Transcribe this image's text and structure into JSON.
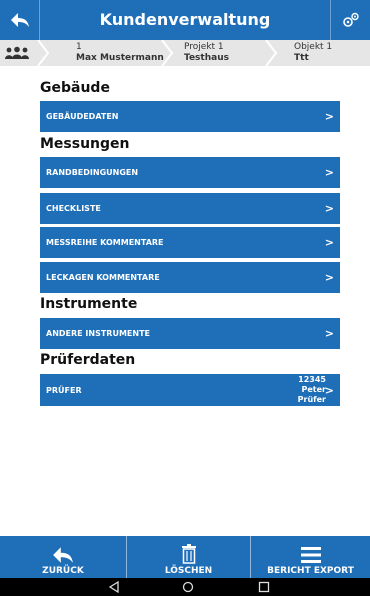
{
  "header": {
    "title": "Kundenverwaltung"
  },
  "breadcrumb": [
    {
      "line1": "1",
      "line2": "Max Mustermann"
    },
    {
      "line1": "Projekt 1",
      "line2": "Testhaus"
    },
    {
      "line1": "Objekt 1",
      "line2": "Ttt"
    }
  ],
  "sections": {
    "gebaeude": {
      "title": "Gebäude",
      "items": [
        "GEBÄUDEDATEN"
      ]
    },
    "messungen": {
      "title": "Messungen",
      "items": [
        "RANDBEDINGUNGEN",
        "CHECKLISTE",
        "MESSREIHE KOMMENTARE",
        "LECKAGEN KOMMENTARE"
      ]
    },
    "instrumente": {
      "title": "Instrumente",
      "items": [
        "ANDERE INSTRUMENTE"
      ]
    },
    "prueferdaten": {
      "title": "Prüferdaten",
      "items": [
        "PRÜFER"
      ],
      "pruefer_info": [
        "12345",
        "Peter",
        "Prüfer"
      ]
    }
  },
  "arrow_symbol": ">",
  "bottom_bar": {
    "back_label": "ZURÜCK",
    "delete_label": "LÖSCHEN",
    "export_label": "BERICHT EXPORT"
  },
  "colors": {
    "primary": "#1f6fb8",
    "breadcrumb_bg": "#e6e6e6",
    "nav_bar": "#000000"
  },
  "icons": [
    "back-arrow-icon",
    "gears-icon",
    "people-icon",
    "trash-icon",
    "menu-lines-icon",
    "nav-back-icon",
    "nav-home-icon",
    "nav-recents-icon"
  ]
}
